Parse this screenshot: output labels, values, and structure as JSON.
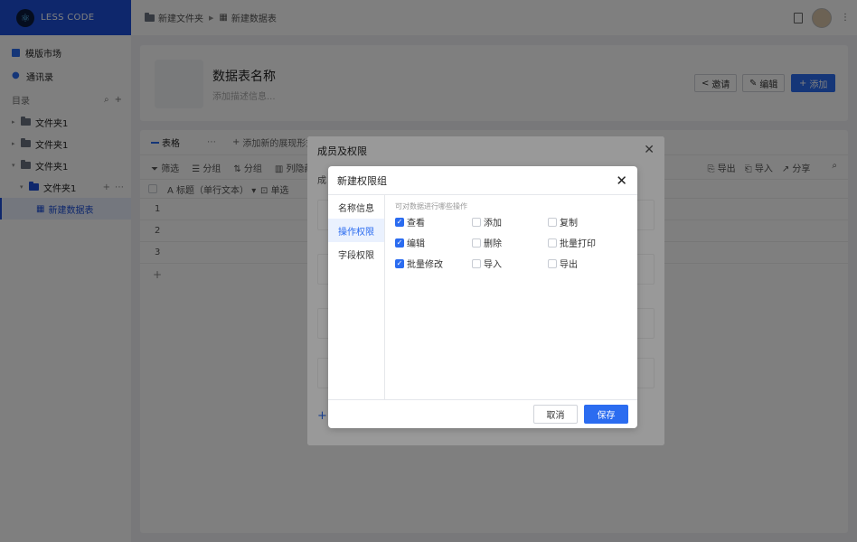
{
  "app": {
    "logo_text": "LESS CODE"
  },
  "sidebar": {
    "items": [
      {
        "label": "模版市场",
        "icon": "template-grid-icon"
      },
      {
        "label": "通讯录",
        "icon": "user-icon"
      }
    ],
    "directory_label": "目录",
    "tree": [
      {
        "label": "文件夹1"
      },
      {
        "label": "文件夹1"
      },
      {
        "label": "文件夹1"
      },
      {
        "label": "文件夹1"
      },
      {
        "label": "新建数据表"
      }
    ]
  },
  "breadcrumb": {
    "folder": "新建文件夹",
    "table": "新建数据表"
  },
  "header": {
    "title": "数据表名称",
    "description_placeholder": "添加描述信息...",
    "invite_label": "邀请",
    "edit_label": "编辑",
    "add_label": "添加"
  },
  "views": {
    "tab_label": "表格",
    "add_view_label": "添加新的展现形式"
  },
  "toolbar": {
    "filter": "筛选",
    "group": "分组",
    "sort": "分组",
    "hide": "列隐藏",
    "export": "导出",
    "import": "导入",
    "share": "分享"
  },
  "grid": {
    "title_col": "标题（单行文本）",
    "select_col": "单选",
    "rows": [
      "1",
      "2",
      "3"
    ]
  },
  "outer_modal": {
    "title": "成员及权限",
    "sub_label": "成"
  },
  "inner_modal": {
    "title": "新建权限组",
    "nav": [
      "名称信息",
      "操作权限",
      "字段权限"
    ],
    "hint": "可对数据进行哪些操作",
    "permissions": [
      {
        "label": "查看",
        "checked": true
      },
      {
        "label": "添加",
        "checked": false
      },
      {
        "label": "复制",
        "checked": false
      },
      {
        "label": "编辑",
        "checked": true
      },
      {
        "label": "删除",
        "checked": false
      },
      {
        "label": "批量打印",
        "checked": false
      },
      {
        "label": "批量修改",
        "checked": true
      },
      {
        "label": "导入",
        "checked": false
      },
      {
        "label": "导出",
        "checked": false
      }
    ],
    "cancel_label": "取消",
    "save_label": "保存"
  },
  "colors": {
    "primary": "#2b6cf0",
    "logo_bg": "#1c4fd8"
  }
}
